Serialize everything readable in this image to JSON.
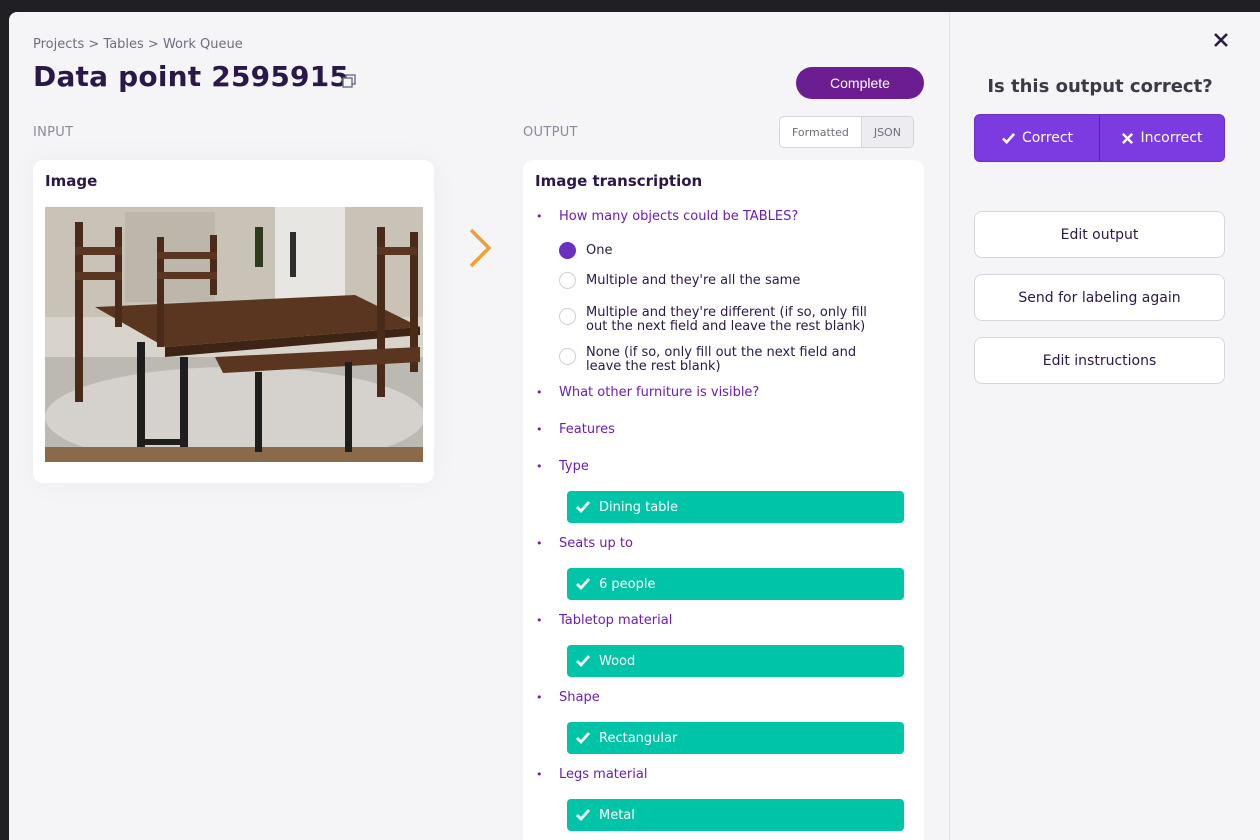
{
  "breadcrumb": "Projects > Tables > Work Queue",
  "title": "Data point 2595915",
  "complete_label": "Complete",
  "input_label": "INPUT",
  "output_label": "OUTPUT",
  "view_toggle": {
    "formatted": "Formatted",
    "json": "JSON",
    "selected": "JSON"
  },
  "input_card": {
    "heading": "Image"
  },
  "output_card": {
    "heading": "Image transcription",
    "q1": "How many objects could be TABLES?",
    "options": [
      {
        "label": "One",
        "selected": true
      },
      {
        "label": "Multiple and they're all the same",
        "selected": false
      },
      {
        "label": "Multiple and they're different (if so, only fill out the next field and leave the rest blank)",
        "selected": false
      },
      {
        "label": "None (if so, only fill out the next field and leave the rest blank)",
        "selected": false
      }
    ],
    "q2": "What other furniture is visible?",
    "q3": "Features",
    "fields": [
      {
        "label": "Type",
        "value": "Dining table"
      },
      {
        "label": "Seats up to",
        "value": "6 people"
      },
      {
        "label": "Tabletop material",
        "value": "Wood"
      },
      {
        "label": "Shape",
        "value": "Rectangular"
      },
      {
        "label": "Legs material",
        "value": "Metal"
      }
    ]
  },
  "side": {
    "question": "Is this output correct?",
    "correct": "Correct",
    "incorrect": "Incorrect",
    "edit_output": "Edit output",
    "send_again": "Send for labeling again",
    "edit_instructions": "Edit instructions"
  },
  "colors": {
    "accent": "#6b1d91",
    "verdict": "#7b3be0",
    "answer": "#00c4a7",
    "arrow": "#f0a030"
  }
}
